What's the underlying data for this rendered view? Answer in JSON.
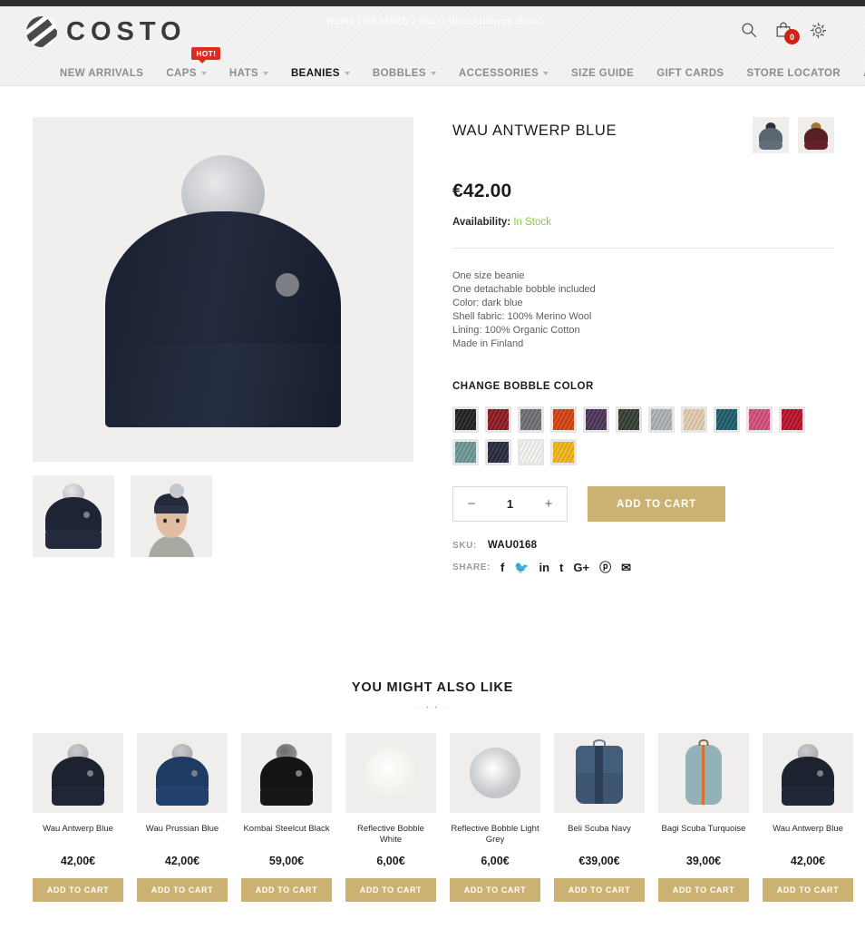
{
  "header": {
    "logo_text": "COSTO",
    "breadcrumb": "Home / BEANIES / Wau / Wau Antwerp Blue",
    "cart_count": "0",
    "icons": {
      "search": "search-icon",
      "cart": "shopping-bag-icon",
      "settings": "gear-icon"
    }
  },
  "nav": {
    "hot_badge": "HOT!",
    "items": [
      {
        "label": "NEW ARRIVALS",
        "caret": false,
        "active": false
      },
      {
        "label": "CAPS",
        "caret": true,
        "active": false
      },
      {
        "label": "HATS",
        "caret": true,
        "active": false
      },
      {
        "label": "BEANIES",
        "caret": true,
        "active": true
      },
      {
        "label": "BOBBLES",
        "caret": true,
        "active": false
      },
      {
        "label": "ACCESSORIES",
        "caret": true,
        "active": false
      },
      {
        "label": "SIZE GUIDE",
        "caret": false,
        "active": false
      },
      {
        "label": "GIFT CARDS",
        "caret": false,
        "active": false
      },
      {
        "label": "STORE LOCATOR",
        "caret": false,
        "active": false
      },
      {
        "label": "ABOUT US",
        "caret": false,
        "active": false
      }
    ]
  },
  "product": {
    "title": "WAU ANTWERP BLUE",
    "price": "€42.00",
    "availability_label": "Availability:",
    "availability_value": "In Stock",
    "description": [
      "One size beanie",
      "One detachable bobble included",
      "Color: dark blue",
      "Shell fabric: 100% Merino Wool",
      "Lining: 100% Organic Cotton",
      "Made in Finland"
    ],
    "bobble_section_label": "CHANGE BOBBLE COLOR",
    "bobble_colors": [
      {
        "name": "black",
        "hex": "#23211f"
      },
      {
        "name": "dark-red",
        "hex": "#8e1b22"
      },
      {
        "name": "grey",
        "hex": "#6f7276"
      },
      {
        "name": "orange",
        "hex": "#d9430f"
      },
      {
        "name": "purple",
        "hex": "#4e3559"
      },
      {
        "name": "dark-green",
        "hex": "#363f33"
      },
      {
        "name": "light-grey",
        "hex": "#b2b5b9"
      },
      {
        "name": "beige",
        "hex": "#e8cfb3"
      },
      {
        "name": "teal",
        "hex": "#1f5f6e"
      },
      {
        "name": "pink",
        "hex": "#d9507e"
      },
      {
        "name": "red",
        "hex": "#bd1129"
      },
      {
        "name": "sage",
        "hex": "#6f9a99"
      },
      {
        "name": "navy",
        "hex": "#262a3d"
      },
      {
        "name": "white",
        "hex": "#fbfbf8"
      },
      {
        "name": "yellow",
        "hex": "#f5bb19"
      }
    ],
    "variant_thumbs": [
      {
        "name": "variant-grey-blue",
        "body": "#5a6670",
        "pom": "#2b3239"
      },
      {
        "name": "variant-burgundy",
        "body": "#5d1f27",
        "pom": "#a07a33"
      }
    ],
    "quantity": "1",
    "qty_minus": "−",
    "qty_plus": "+",
    "add_to_cart": "ADD TO CART",
    "sku_label": "SKU:",
    "sku_value": "WAU0168",
    "share_label": "SHARE:",
    "share_icons": [
      {
        "name": "facebook-icon",
        "glyph": "f"
      },
      {
        "name": "twitter-icon",
        "glyph": "🐦"
      },
      {
        "name": "linkedin-icon",
        "glyph": "in"
      },
      {
        "name": "tumblr-icon",
        "glyph": "t"
      },
      {
        "name": "google-plus-icon",
        "glyph": "G+"
      },
      {
        "name": "pinterest-icon",
        "glyph": "ⓟ"
      },
      {
        "name": "email-icon",
        "glyph": "✉"
      }
    ]
  },
  "related": {
    "heading": "YOU MIGHT ALSO LIKE",
    "ornament": "···▪·▪···",
    "button_label": "ADD TO CART",
    "items": [
      {
        "name": "Wau Antwerp Blue",
        "price": "42,00€",
        "art": "beanie",
        "body": "#1c2230",
        "pom": "#c8cacd"
      },
      {
        "name": "Wau Prussian Blue",
        "price": "42,00€",
        "art": "beanie",
        "body": "#1f3a63",
        "pom": "#c8cacd"
      },
      {
        "name": "Kombai Steelcut Black",
        "price": "59,00€",
        "art": "beanie",
        "body": "#141414",
        "pom": "#6a6a6a"
      },
      {
        "name": "Reflective Bobble White",
        "price": "6,00€",
        "art": "pom",
        "body": "#f2f1ec",
        "pom": "#eceade"
      },
      {
        "name": "Reflective Bobble Light Grey",
        "price": "6,00€",
        "art": "pom",
        "body": "#c7c9cc",
        "pom": "#b9bcc0"
      },
      {
        "name": "Beli Scuba Navy",
        "price": "€39,00€",
        "art": "pack",
        "body": "#3d5570",
        "pom": "#2c3e55"
      },
      {
        "name": "Bagi Scuba Turquoise",
        "price": "39,00€",
        "art": "pack2",
        "body": "#93b2b8",
        "pom": "#d4702f"
      },
      {
        "name": "Wau Antwerp Blue",
        "price": "42,00€",
        "art": "beanie",
        "body": "#1c2230",
        "pom": "#c8cacd"
      }
    ]
  },
  "colors": {
    "accent_gold": "#cbb273",
    "badge_red": "#d32015",
    "stock_green": "#8ec63f",
    "nav_inactive": "#8d8d8d"
  }
}
